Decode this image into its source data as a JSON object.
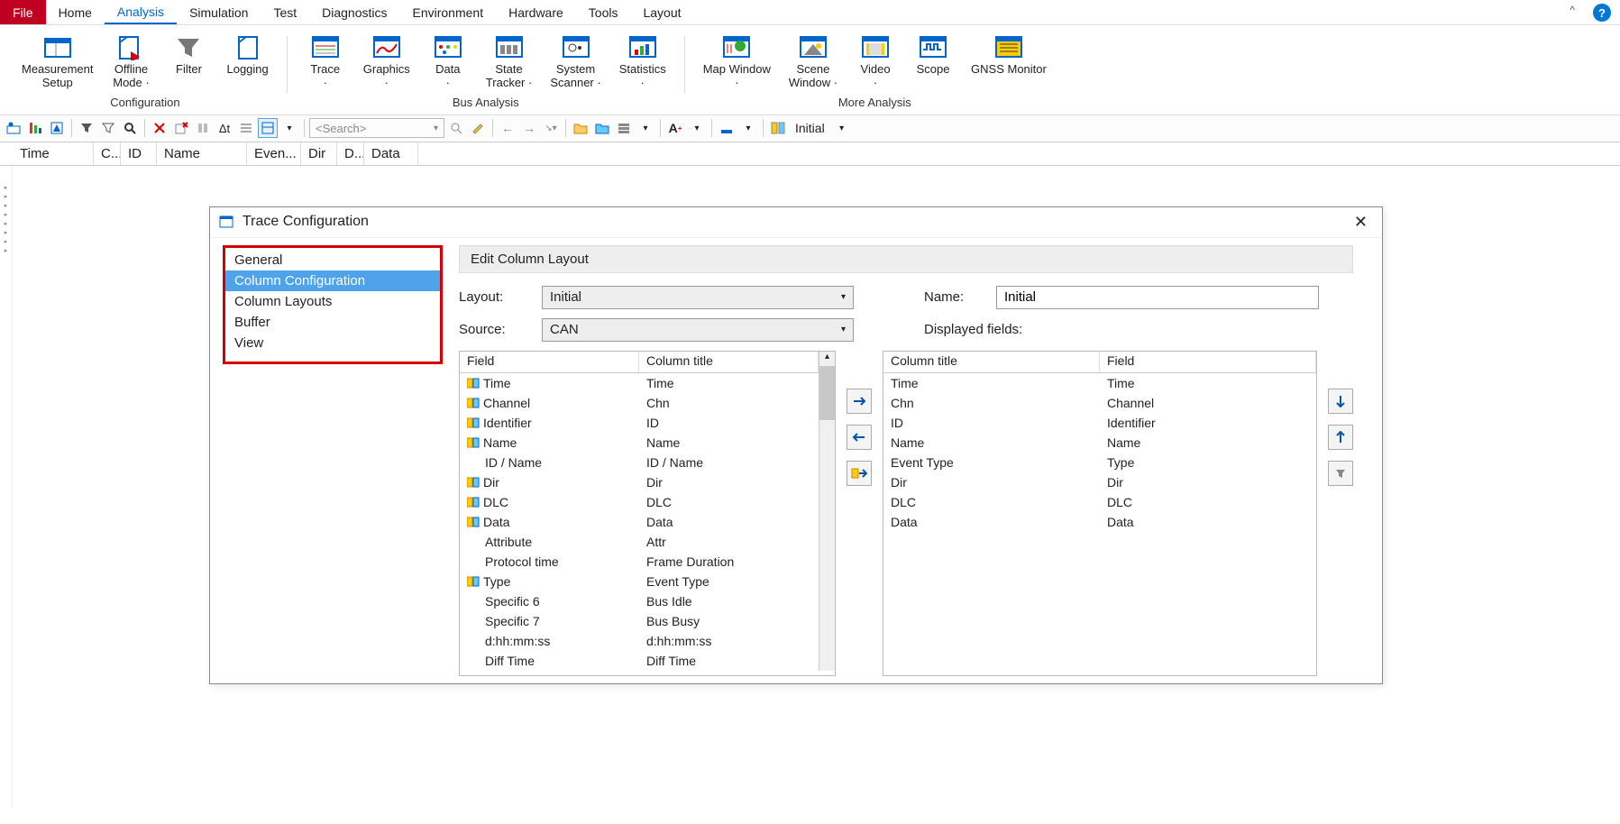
{
  "menu": {
    "items": [
      "File",
      "Home",
      "Analysis",
      "Simulation",
      "Test",
      "Diagnostics",
      "Environment",
      "Hardware",
      "Tools",
      "Layout"
    ],
    "active": "Analysis",
    "file": "File"
  },
  "ribbon": {
    "groups": [
      {
        "caption": "Configuration",
        "items": [
          {
            "label": "Measurement\nSetup",
            "icon": "meas"
          },
          {
            "label": "Offline\nMode ·",
            "icon": "offline"
          },
          {
            "label": "Filter",
            "icon": "filter"
          },
          {
            "label": "Logging",
            "icon": "logging"
          }
        ]
      },
      {
        "caption": "Bus Analysis",
        "items": [
          {
            "label": "Trace\n·",
            "icon": "trace"
          },
          {
            "label": "Graphics\n·",
            "icon": "graphics"
          },
          {
            "label": "Data\n·",
            "icon": "data"
          },
          {
            "label": "State\nTracker ·",
            "icon": "state"
          },
          {
            "label": "System\nScanner ·",
            "icon": "scanner"
          },
          {
            "label": "Statistics\n·",
            "icon": "stats"
          }
        ]
      },
      {
        "caption": "More Analysis",
        "items": [
          {
            "label": "Map Window\n·",
            "icon": "map"
          },
          {
            "label": "Scene\nWindow ·",
            "icon": "scene"
          },
          {
            "label": "Video\n·",
            "icon": "video"
          },
          {
            "label": "Scope",
            "icon": "scope"
          },
          {
            "label": "GNSS Monitor",
            "icon": "gnss"
          }
        ]
      }
    ]
  },
  "toolbar": {
    "search_placeholder": "<Search>",
    "initial": "Initial"
  },
  "columns": [
    "Time",
    "C...",
    "ID",
    "Name",
    "Even...",
    "Dir",
    "D...",
    "Data"
  ],
  "dialog": {
    "title": "Trace Configuration",
    "nav": [
      "General",
      "Column Configuration",
      "Column Layouts",
      "Buffer",
      "View"
    ],
    "nav_selected": "Column Configuration",
    "panel_title": "Edit Column Layout",
    "layout_label": "Layout:",
    "layout_value": "Initial",
    "source_label": "Source:",
    "source_value": "CAN",
    "name_label": "Name:",
    "name_value": "Initial",
    "displayed_label": "Displayed fields:",
    "left_head": [
      "Field",
      "Column title"
    ],
    "right_head": [
      "Column title",
      "Field"
    ],
    "left": [
      {
        "f": "Time",
        "t": "Time",
        "i": true
      },
      {
        "f": "Channel",
        "t": "Chn",
        "i": true
      },
      {
        "f": "Identifier",
        "t": "ID",
        "i": true
      },
      {
        "f": "Name",
        "t": "Name",
        "i": true
      },
      {
        "f": "ID / Name",
        "t": "ID / Name",
        "i": false,
        "indent": true
      },
      {
        "f": "Dir",
        "t": "Dir",
        "i": true
      },
      {
        "f": "DLC",
        "t": "DLC",
        "i": true
      },
      {
        "f": "Data",
        "t": "Data",
        "i": true
      },
      {
        "f": "Attribute",
        "t": "Attr",
        "i": false,
        "indent": true
      },
      {
        "f": "Protocol time",
        "t": "Frame Duration",
        "i": false,
        "indent": true
      },
      {
        "f": "Type",
        "t": "Event Type",
        "i": true
      },
      {
        "f": "Specific 6",
        "t": "Bus Idle",
        "i": false,
        "indent": true
      },
      {
        "f": "Specific 7",
        "t": "Bus Busy",
        "i": false,
        "indent": true
      },
      {
        "f": "d:hh:mm:ss",
        "t": "d:hh:mm:ss",
        "i": false,
        "indent": true
      },
      {
        "f": "Diff Time",
        "t": "Diff Time",
        "i": false,
        "indent": true
      }
    ],
    "right": [
      {
        "t": "Time",
        "f": "Time"
      },
      {
        "t": "Chn",
        "f": "Channel"
      },
      {
        "t": "ID",
        "f": "Identifier"
      },
      {
        "t": "Name",
        "f": "Name"
      },
      {
        "t": "Event Type",
        "f": "Type"
      },
      {
        "t": "Dir",
        "f": "Dir"
      },
      {
        "t": "DLC",
        "f": "DLC"
      },
      {
        "t": "Data",
        "f": "Data"
      }
    ]
  }
}
